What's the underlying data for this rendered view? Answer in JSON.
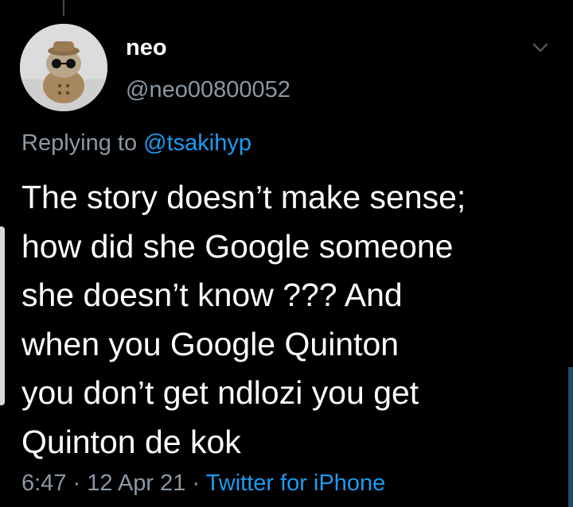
{
  "tweet": {
    "display_name": "neo",
    "handle": "@neo00800052",
    "replying_prefix": "Replying to ",
    "replying_to": "@tsakihyp",
    "text": "The story doesn’t make sense;\nhow did she Google someone\nshe doesn’t know ??? And\nwhen you Google Quinton\nyou don’t get ndlozi you get\nQuinton de kok",
    "time": "6:47",
    "separator_1": " · ",
    "date": "12 Apr 21",
    "separator_2": " · ",
    "source": "Twitter for iPhone"
  },
  "icons": {
    "more": "chevron-down-icon",
    "avatar": "avatar-image"
  },
  "colors": {
    "background": "#000000",
    "primary_text": "#ffffff",
    "secondary_text": "#8b98a5",
    "accent": "#1d9bf0"
  }
}
